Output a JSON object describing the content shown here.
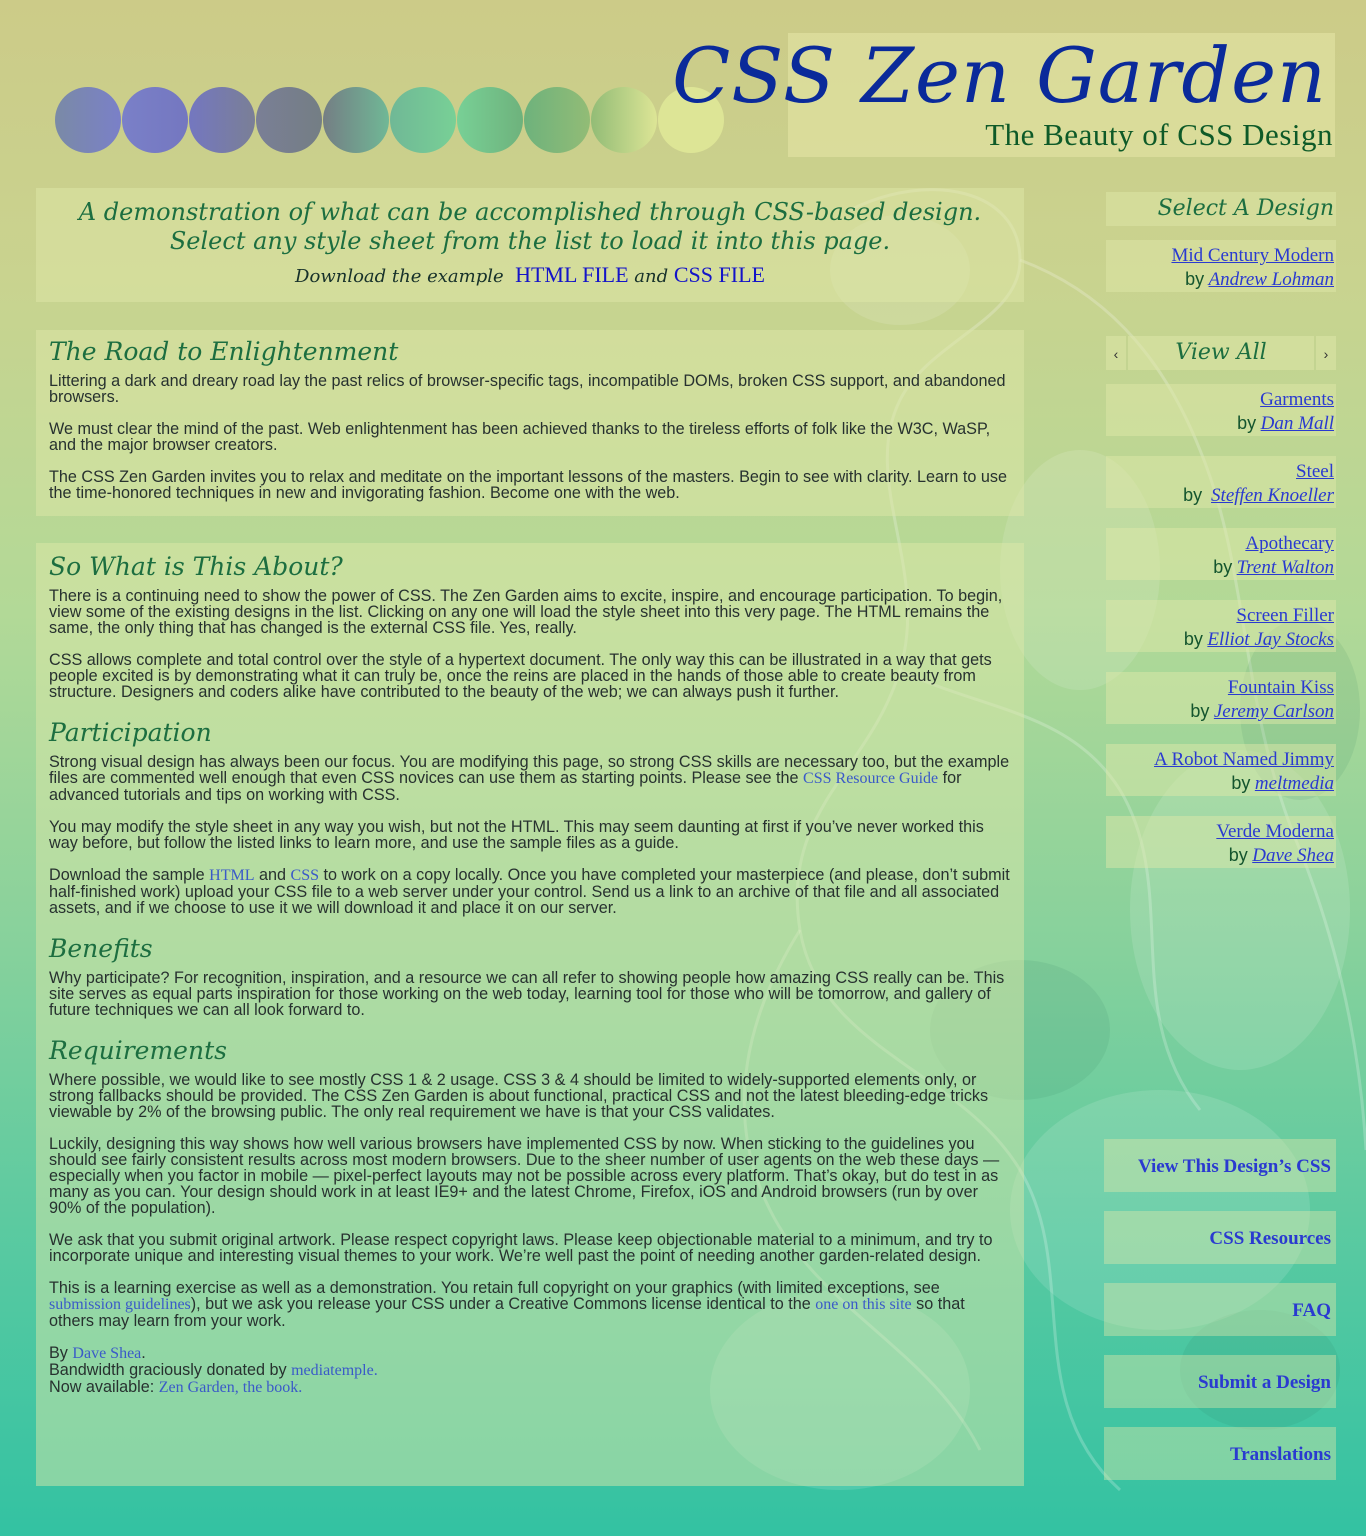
{
  "header": {
    "title": "CSS Zen Garden",
    "tagline": "The Beauty of CSS Design",
    "circle_colors": [
      "#7a8aa6",
      "#7a80c8",
      "#7477c0",
      "#7a7f96",
      "#747e84",
      "#70b896",
      "#78d096",
      "#6eb27c",
      "#92bc76",
      "#dde596"
    ]
  },
  "intro": {
    "line1": "A demonstration of what can be accomplished through CSS-based design.",
    "line2": "Select any style sheet from the list to load it into this page.",
    "download_lead": "Download the example",
    "html_file": "HTML FILE",
    "and": "and",
    "css_file": "CSS FILE"
  },
  "road": {
    "heading": "The Road to Enlightenment",
    "p1": "Littering a dark and dreary road lay the past relics of browser-specific tags, incompatible DOMs, broken CSS support, and abandoned browsers.",
    "p2": "We must clear the mind of the past. Web enlightenment has been achieved thanks to the tireless efforts of folk like the W3C, WaSP, and the major browser creators.",
    "p3": "The CSS Zen Garden invites you to relax and meditate on the important lessons of the masters. Begin to see with clarity. Learn to use the time-honored techniques in new and invigorating fashion. Become one with the web."
  },
  "about": {
    "heading": "So What is This About?",
    "p1": "There is a continuing need to show the power of CSS. The Zen Garden aims to excite, inspire, and encourage participation. To begin, view some of the existing designs in the list. Clicking on any one will load the style sheet into this very page. The HTML remains the same, the only thing that has changed is the external CSS file. Yes, really.",
    "p2": "CSS allows complete and total control over the style of a hypertext document. The only way this can be illustrated in a way that gets people excited is by demonstrating what it can truly be, once the reins are placed in the hands of those able to create beauty from structure. Designers and coders alike have contributed to the beauty of the web; we can always push it further."
  },
  "participation": {
    "heading": "Participation",
    "p1_a": "Strong visual design has always been our focus. You are modifying this page, so strong CSS skills are necessary too, but the example files are commented well enough that even CSS novices can use them as starting points. Please see the",
    "p1_link": "CSS Resource Guide",
    "p1_b": "for advanced tutorials and tips on working with CSS.",
    "p2": "You may modify the style sheet in any way you wish, but not the HTML. This may seem daunting at first if you’ve never worked this way before, but follow the listed links to learn more, and use the sample files as a guide.",
    "p3_a": "Download the sample",
    "p3_html": "HTML",
    "p3_and": "and",
    "p3_css": "CSS",
    "p3_b": "to work on a copy locally. Once you have completed your masterpiece (and please, don’t submit half-finished work) upload your CSS file to a web server under your control. Send us a link to an archive of that file and all associated assets, and if we choose to use it we will download it and place it on our server."
  },
  "benefits": {
    "heading": "Benefits",
    "p1": "Why participate? For recognition, inspiration, and a resource we can all refer to showing people how amazing CSS really can be. This site serves as equal parts inspiration for those working on the web today, learning tool for those who will be tomorrow, and gallery of future techniques we can all look forward to."
  },
  "requirements": {
    "heading": "Requirements",
    "p1": "Where possible, we would like to see mostly CSS 1 & 2 usage. CSS 3 & 4 should be limited to widely-supported elements only, or strong fallbacks should be provided. The CSS Zen Garden is about functional, practical CSS and not the latest bleeding-edge tricks viewable by 2% of the browsing public. The only real requirement we have is that your CSS validates.",
    "p2": "Luckily, designing this way shows how well various browsers have implemented CSS by now. When sticking to the guidelines you should see fairly consistent results across most modern browsers. Due to the sheer number of user agents on the web these days — especially when you factor in mobile — pixel-perfect layouts may not be possible across every platform. That’s okay, but do test in as many as you can. Your design should work in at least IE9+ and the latest Chrome, Firefox, iOS and Android browsers (run by over 90% of the population).",
    "p3": "We ask that you submit original artwork. Please respect copyright laws. Please keep objectionable material to a minimum, and try to incorporate unique and interesting visual themes to your work. We’re well past the point of needing another garden-related design.",
    "p4_a": "This is a learning exercise as well as a demonstration. You retain full copyright on your graphics (with limited exceptions, see",
    "p4_link1": "submission guidelines",
    "p4_b": "), but we ask you release your CSS under a Creative Commons license identical to the",
    "p4_link2": "one on this site",
    "p4_c": "so that others may learn from your work."
  },
  "footer": {
    "by_label": "By",
    "author": "Dave Shea",
    "period": ".",
    "bandwidth_label": "Bandwidth graciously donated by",
    "host": "mediatemple.",
    "available_label": "Now available:",
    "book": "Zen Garden, the book."
  },
  "sidebar": {
    "select_heading": "Select A Design",
    "by_label": "by",
    "designs": [
      {
        "name": "Mid Century Modern",
        "author": "Andrew Lohman"
      },
      {
        "name": "Garments",
        "author": "Dan Mall"
      },
      {
        "name": "Steel",
        "author": "Steffen Knoeller"
      },
      {
        "name": "Apothecary",
        "author": "Trent Walton"
      },
      {
        "name": "Screen Filler",
        "author": "Elliot Jay Stocks"
      },
      {
        "name": "Fountain Kiss",
        "author": "Jeremy Carlson"
      },
      {
        "name": "A Robot Named Jimmy",
        "author": "meltmedia"
      },
      {
        "name": "Verde Moderna",
        "author": "Dave Shea"
      }
    ],
    "nav": {
      "prev": "‹",
      "view_all": "View All",
      "next": "›"
    },
    "resources": [
      "View This Design’s CSS",
      "CSS Resources",
      "FAQ",
      "Submit a Design",
      "Translations"
    ]
  }
}
